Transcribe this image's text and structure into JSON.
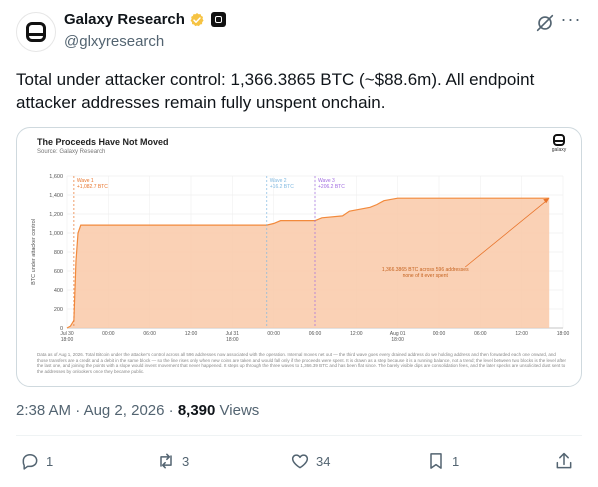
{
  "author": {
    "display_name": "Galaxy Research",
    "handle": "@glxyresearch"
  },
  "tweet": {
    "text": "Total under attacker control: 1,366.3865 BTC (~$88.6m). All endpoint attacker addresses remain fully unspent onchain.",
    "time": "2:38 AM",
    "date": "Aug 2, 2026",
    "views_count": "8,390",
    "views_label": "Views"
  },
  "actions": {
    "replies": "1",
    "reposts": "3",
    "likes": "34",
    "bookmarks": "1"
  },
  "icons": [
    "verified-icon",
    "org-badge-icon",
    "grok-icon",
    "more-icon",
    "reply-icon",
    "repost-icon",
    "like-icon",
    "bookmark-icon",
    "share-icon"
  ],
  "colors": {
    "verified": "#f6c343",
    "area_fill": "#f9c9a8",
    "area_line": "#f28a3c",
    "wave1": "#e8742b",
    "wave2": "#7fb8e0",
    "wave3": "#a06be0",
    "muted": "#536471"
  },
  "chart_data": {
    "type": "area",
    "title": "The Proceeds Have Not Moved",
    "subtitle": "Source: Galaxy Research",
    "logo_text": "galaxy",
    "ylabel": "BTC under attacker control",
    "xlabel": "",
    "ylim": [
      0,
      1600
    ],
    "yticks": [
      "0",
      "200",
      "400",
      "600",
      "800",
      "1,000",
      "1,200",
      "1,400",
      "1,600"
    ],
    "xlim": [
      0,
      52
    ],
    "xticks": [
      {
        "x": 0,
        "label": "Jul 30\n18:00"
      },
      {
        "x": 6,
        "label": "00:00"
      },
      {
        "x": 12,
        "label": "06:00"
      },
      {
        "x": 18,
        "label": "12:00"
      },
      {
        "x": 24,
        "label": "Jul 31\n18:00"
      },
      {
        "x": 30,
        "label": "00:00"
      },
      {
        "x": 36,
        "label": "06:00"
      },
      {
        "x": 42,
        "label": "12:00"
      },
      {
        "x": 48,
        "label": "Aug 01\n18:00"
      },
      {
        "x": 54,
        "label": "00:00"
      },
      {
        "x": 60,
        "label": "06:00"
      },
      {
        "x": 66,
        "label": "12:00"
      },
      {
        "x": 72,
        "label": "18:00"
      }
    ],
    "series": [
      {
        "values": [
          [
            0,
            0
          ],
          [
            0.5,
            20
          ],
          [
            1,
            80
          ],
          [
            1.3,
            700
          ],
          [
            1.6,
            1000
          ],
          [
            2,
            1082.7
          ],
          [
            29,
            1082.7
          ],
          [
            30,
            1100
          ],
          [
            31,
            1130
          ],
          [
            36,
            1130
          ],
          [
            37,
            1160
          ],
          [
            40,
            1180
          ],
          [
            41,
            1230
          ],
          [
            44,
            1270
          ],
          [
            45,
            1300
          ],
          [
            46,
            1340
          ],
          [
            48,
            1366.3865
          ],
          [
            70,
            1366.3865
          ]
        ]
      }
    ],
    "gridlines": true,
    "annotations": [
      {
        "label": "Wave 1",
        "value": "+1,082.7 BTC",
        "x": 1,
        "color": "wave1"
      },
      {
        "label": "Wave 2",
        "value": "+16.2 BTC",
        "x": 29,
        "color": "wave2"
      },
      {
        "label": "Wave 3",
        "value": "+206.2 BTC",
        "x": 36,
        "color": "wave3"
      }
    ],
    "callout": {
      "lines": [
        "1,366.3865 BTC across 596 addresses",
        "none of it ever spent"
      ],
      "target_x": 70,
      "target_y": 1366.3865
    },
    "footnote": "Data as of Aug 1, 2026. Total Bitcoin under the attacker's control across all 596 addresses now associated with the operation. Internal moves net out — the third wave goes every drained address do we holding address and then forwarded each one onward, and those transfers are a credit and a debit in the same block — so the line rises only when new coins are taken and would fall only if the proceeds were spent. It is drawn as a step because it is a running balance, not a trend; the level between two blocks is the level after the last one, and joining the points with a slope would invent movement that never happened. It steps up through the three waves to 1,366.39 BTC and has been flat since. The barely visible dips are consolidation fees, and the later specks are unsolicited dust sent to the addresses by onlookers once they became public."
  }
}
